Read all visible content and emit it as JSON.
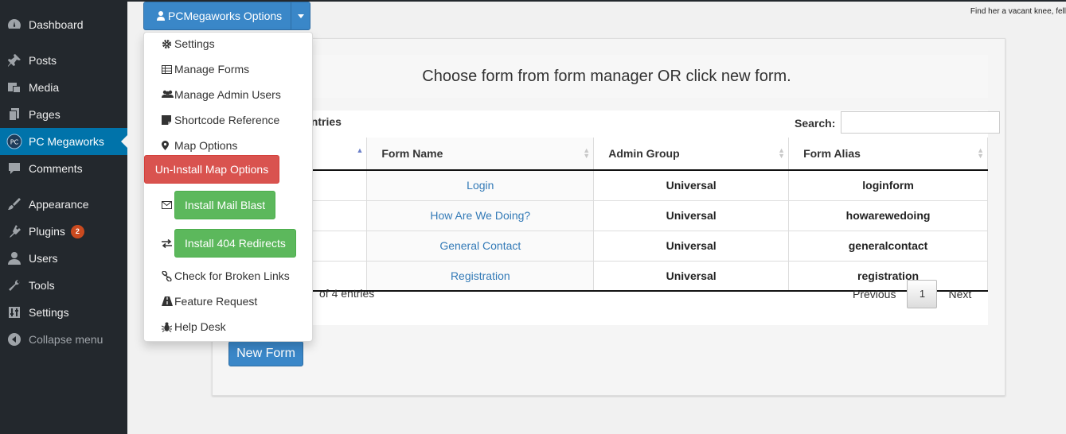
{
  "sidebar": {
    "items": [
      {
        "label": "Dashboard",
        "icon": "dashboard-icon"
      },
      {
        "label": "Posts",
        "icon": "pushpin-icon"
      },
      {
        "label": "Media",
        "icon": "media-icon"
      },
      {
        "label": "Pages",
        "icon": "pages-icon"
      },
      {
        "label": "PC Megaworks",
        "icon": "pc-logo-icon",
        "active": true
      },
      {
        "label": "Comments",
        "icon": "comment-icon"
      },
      {
        "label": "Appearance",
        "icon": "paintbrush-icon"
      },
      {
        "label": "Plugins",
        "icon": "plugin-icon",
        "badge": "2"
      },
      {
        "label": "Users",
        "icon": "user-icon"
      },
      {
        "label": "Tools",
        "icon": "wrench-icon"
      },
      {
        "label": "Settings",
        "icon": "settings-icon"
      },
      {
        "label": "Collapse menu",
        "icon": "collapse-icon"
      }
    ]
  },
  "header": {
    "quote": "Find her a vacant knee, fell",
    "options_button": "PCMegaworks Options"
  },
  "dropdown": {
    "settings": "Settings",
    "manage_forms": "Manage Forms",
    "manage_admin_users": "Manage Admin Users",
    "shortcode_reference": "Shortcode Reference",
    "map_options": "Map Options",
    "uninstall_map_options": "Un-Install Map Options",
    "install_mail_blast": "Install Mail Blast",
    "install_404_redirects": "Install 404 Redirects",
    "check_broken_links": "Check for Broken Links",
    "feature_request": "Feature Request",
    "help_desk": "Help Desk"
  },
  "main": {
    "heading": "Choose form from form manager OR click new form.",
    "entries_label": "entries",
    "search_label": "Search:",
    "search_value": "",
    "columns": [
      "Form Name",
      "Admin Group",
      "Form Alias"
    ],
    "rows": [
      {
        "form_name": "Login",
        "admin_group": "Universal",
        "form_alias": "loginform"
      },
      {
        "form_name": "How Are We Doing?",
        "admin_group": "Universal",
        "form_alias": "howarewedoing"
      },
      {
        "form_name": "General Contact",
        "admin_group": "Universal",
        "form_alias": "generalcontact"
      },
      {
        "form_name": "Registration",
        "admin_group": "Universal",
        "form_alias": "registration"
      }
    ],
    "showing_text": "of 4 entries",
    "pager": {
      "previous": "Previous",
      "current": "1",
      "next": "Next"
    },
    "new_form_label": "New Form"
  },
  "colors": {
    "sidebar_bg": "#23282d",
    "active_blue": "#0073aa",
    "primary": "#3a87c8",
    "danger": "#d9534f",
    "success": "#5cb85c",
    "link": "#337ab7"
  }
}
